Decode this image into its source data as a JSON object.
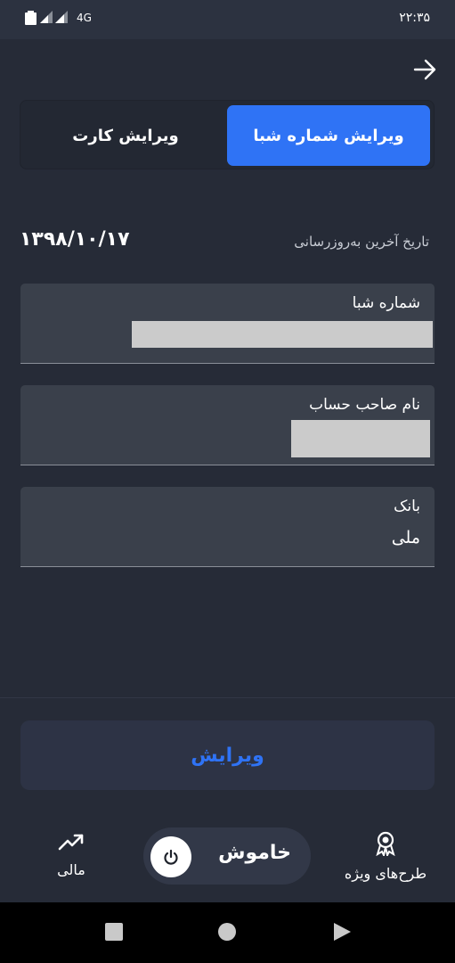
{
  "status_bar": {
    "network_type": "4G",
    "time": "۲۲:۳۵"
  },
  "tabs": {
    "active_label": "ویرایش شماره شبا",
    "inactive_label": "ویرایش کارت"
  },
  "last_update": {
    "label": "تاریخ آخرین به‌روزرسانی",
    "value": "۱۳۹۸/۱۰/۱۷"
  },
  "fields": {
    "sheba": {
      "label": "شماره شبا"
    },
    "holder": {
      "label": "نام صاحب حساب"
    },
    "bank": {
      "label": "بانک",
      "value": "ملی"
    }
  },
  "edit_button": {
    "label": "ویرایش"
  },
  "bottom_nav": {
    "special_label": "طرح‌های ویژه",
    "power_label": "خاموش",
    "finance_label": "مالی"
  },
  "colors": {
    "accent": "#2f73f5",
    "background": "#262b37",
    "field_bg": "#3a404b"
  }
}
